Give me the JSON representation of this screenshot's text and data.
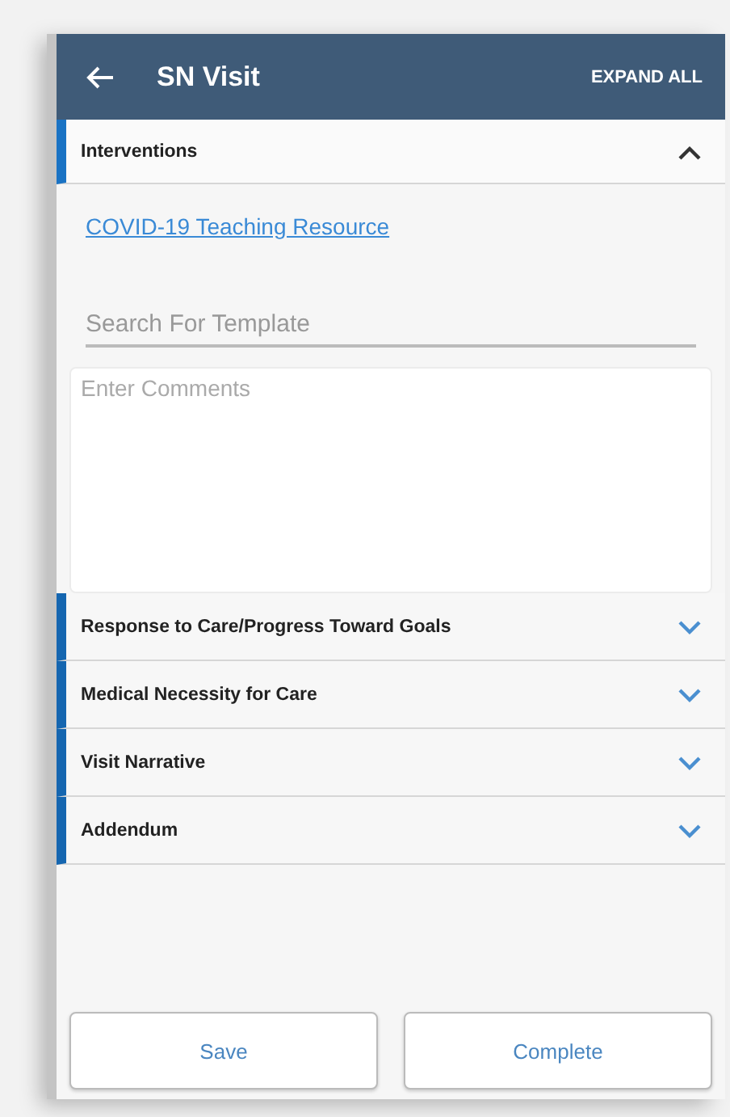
{
  "header": {
    "title": "SN Visit",
    "action": "EXPAND ALL"
  },
  "sections": [
    {
      "title": "Interventions",
      "expanded": true,
      "link": "COVID-19 Teaching Resource",
      "search": {
        "placeholder": "Search For Template"
      },
      "comments": {
        "placeholder": "Enter Comments"
      }
    },
    {
      "title": "Response to Care/Progress Toward Goals",
      "expanded": false
    },
    {
      "title": "Medical Necessity for Care",
      "expanded": false
    },
    {
      "title": "Visit Narrative",
      "expanded": false
    },
    {
      "title": "Addendum",
      "expanded": false
    }
  ],
  "buttons": [
    "Save",
    "Complete"
  ]
}
